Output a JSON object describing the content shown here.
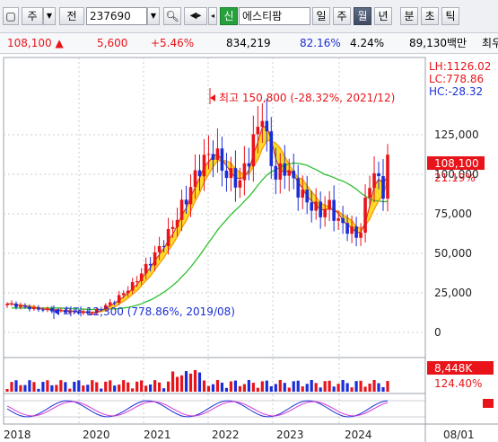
{
  "toolbar": {
    "market": "주",
    "code_prefix": "전",
    "stock_code": "237690",
    "green_badge": "신",
    "stock_name": "에스티팜",
    "periods": [
      "일",
      "주",
      "월",
      "년"
    ],
    "active_period": "월",
    "extra_buttons": [
      "분",
      "초",
      "틱"
    ]
  },
  "quote": {
    "price": "108,100",
    "change": "5,600",
    "change_rate": "+5.46%",
    "volume": "834,219",
    "vol_ratio": "82.16%",
    "turnover": "4.24%",
    "trade_value": "89,130백만",
    "cutoff": "최우"
  },
  "chart": {
    "info_lines": [
      "LH:1126.02",
      "LC:778.86",
      "HC:-28.32"
    ],
    "high_annotation": "최고 150,800 (-28.32%, 2021/12)",
    "low_annotation": "최저 12,300 (778.86%, 2019/08)",
    "price_ticks": [
      "125,000",
      "100,000",
      "75,000",
      "50,000",
      "25,000",
      "0"
    ],
    "price_ticks_values": [
      125000,
      100000,
      75000,
      50000,
      25000,
      0
    ],
    "current_price_label": "108,100",
    "current_price_pct": "21.19%",
    "volume_label": "8,448K",
    "volume_pct": "124.40%",
    "x_labels": [
      "2018",
      "2020",
      "2021",
      "2022",
      "2023",
      "2024",
      "08/01"
    ]
  },
  "colors": {
    "up": "#e8141a",
    "down": "#1a2ed8",
    "ma_short": "#cc3333",
    "ma_mid": "#f39c12",
    "ma_long": "#2fbf2f",
    "band_fill": "#ffd400"
  },
  "chart_data": {
    "type": "candlestick",
    "granularity": "monthly",
    "ylim": [
      0,
      160000
    ],
    "high": {
      "value": 150800,
      "date": "2021/12"
    },
    "low": {
      "value": 12300,
      "date": "2019/08"
    },
    "last_close": 108100
  }
}
